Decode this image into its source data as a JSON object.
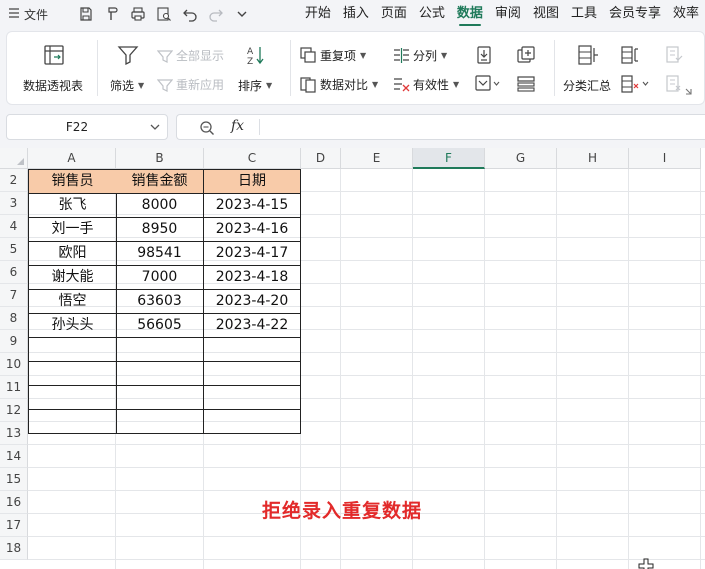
{
  "menubar": {
    "file_label": "文件",
    "tabs": [
      "开始",
      "插入",
      "页面",
      "公式",
      "数据",
      "审阅",
      "视图",
      "工具",
      "会员专享",
      "效率"
    ],
    "active_tab": "数据"
  },
  "ribbon": {
    "pivot_table": "数据透视表",
    "filter": "筛选",
    "show_all": "全部显示",
    "reapply": "重新应用",
    "sort": "排序",
    "duplicates": "重复项",
    "data_compare": "数据对比",
    "split_column": "分列",
    "validity": "有效性",
    "subtotal": "分类汇总"
  },
  "formula_bar": {
    "name_box": "F22",
    "fx_label": "fx",
    "formula": ""
  },
  "sheet": {
    "columns": [
      "A",
      "B",
      "C",
      "D",
      "E",
      "F",
      "G",
      "H",
      "I"
    ],
    "selected_column": "F",
    "rows": [
      "2",
      "3",
      "4",
      "5",
      "6",
      "7",
      "8",
      "9",
      "10",
      "11",
      "12",
      "13",
      "14",
      "15",
      "16",
      "17",
      "18"
    ],
    "table_headers": [
      "销售员",
      "销售金额",
      "日期"
    ],
    "table_rows": [
      [
        "张飞",
        "8000",
        "2023-4-15"
      ],
      [
        "刘一手",
        "8950",
        "2023-4-16"
      ],
      [
        "欧阳",
        "98541",
        "2023-4-17"
      ],
      [
        "谢大能",
        "7000",
        "2023-4-18"
      ],
      [
        "悟空",
        "63603",
        "2023-4-20"
      ],
      [
        "孙头头",
        "56605",
        "2023-4-22"
      ],
      [
        "",
        "",
        ""
      ],
      [
        "",
        "",
        ""
      ],
      [
        "",
        "",
        ""
      ],
      [
        "",
        "",
        ""
      ]
    ]
  },
  "overlay_caption": "拒绝录入重复数据",
  "colors": {
    "accent": "#1f7a5a",
    "header_fill": "#f8cba9",
    "caption": "#e22a2a"
  }
}
